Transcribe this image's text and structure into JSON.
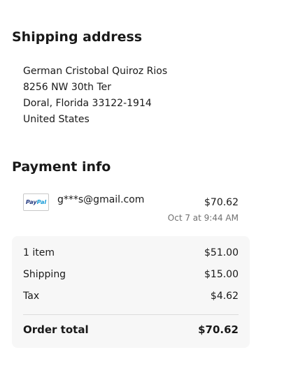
{
  "shipping": {
    "title": "Shipping address",
    "name": "German Cristobal Quiroz Rios",
    "street": "8256 NW 30th Ter",
    "city_line": "Doral, Florida 33122-1914",
    "country": "United States"
  },
  "payment": {
    "title": "Payment info",
    "method_icon": "paypal-logo",
    "method_logo_pay": "Pay",
    "method_logo_pal": "Pal",
    "email": "g***s@gmail.com",
    "amount": "$70.62",
    "date": "Oct 7 at 9:44 AM"
  },
  "summary": {
    "items_label": "1 item",
    "items_value": "$51.00",
    "shipping_label": "Shipping",
    "shipping_value": "$15.00",
    "tax_label": "Tax",
    "tax_value": "$4.62",
    "total_label": "Order total",
    "total_value": "$70.62"
  },
  "colors": {
    "text": "#191919",
    "muted": "#707070",
    "summary_bg": "#f7f7f7",
    "paypal_dark": "#253b80",
    "paypal_light": "#179bd7"
  }
}
